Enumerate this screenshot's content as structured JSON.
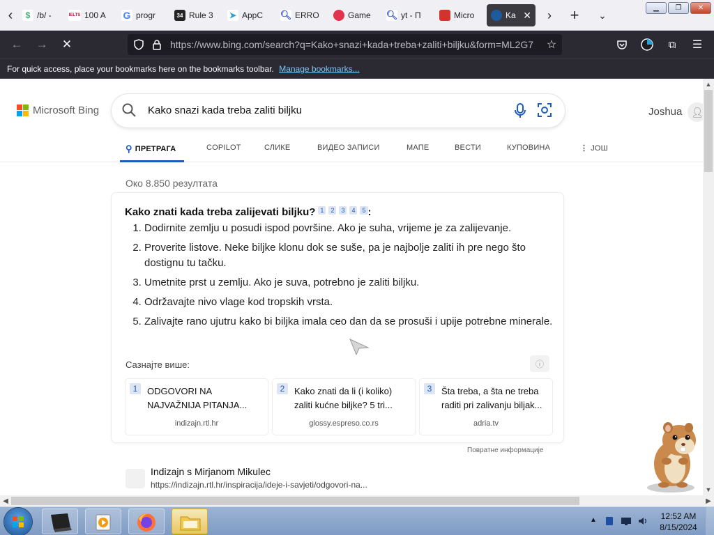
{
  "browser": {
    "tabs": [
      {
        "label": "/b/ - ",
        "icon": "page-icon",
        "color": "#4a7"
      },
      {
        "label": "100 A",
        "icon": "ielts-icon",
        "color": "#c8102e",
        "badge": "IELTS"
      },
      {
        "label": "progr",
        "icon": "google-icon",
        "color": "#4285f4"
      },
      {
        "label": "Rule 3",
        "icon": "rule34-icon",
        "color": "#2b5"
      },
      {
        "label": "AppC",
        "icon": "telegram-icon",
        "color": "#2aa1da"
      },
      {
        "label": "ERRO",
        "icon": "search-icon",
        "color": "#3b5bdb"
      },
      {
        "label": "Game",
        "icon": "game-icon",
        "color": "#e2334c"
      },
      {
        "label": "yt - П",
        "icon": "search-icon",
        "color": "#3b5bdb"
      },
      {
        "label": "Micro",
        "icon": "microsoft-icon",
        "color": "#d0342c"
      },
      {
        "label": "Kak",
        "icon": "bing-icon",
        "color": "#1e5a9e",
        "active": true
      }
    ],
    "url": "https://www.bing.com/search?q=Kako+snazi+kada+treba+zaliti+biljku&form=ML2G7",
    "bookmarks_hint": "For quick access, place your bookmarks here on the bookmarks toolbar.",
    "bookmarks_link": "Manage bookmarks..."
  },
  "bing": {
    "logo_text": "Microsoft Bing",
    "query": "Kako snazi kada treba zaliti biljku",
    "user_name": "Joshua",
    "tabs": [
      "ПРЕТРАГА",
      "COPILOT",
      "СЛИКЕ",
      "ВИДЕО ЗАПИСИ",
      "МАПЕ",
      "ВЕСТИ",
      "КУПОВИНА",
      "ЈОШ"
    ],
    "result_count": "Око 8.850 резултата",
    "answer": {
      "title": "Kako znati kada treba zalijevati biljku?",
      "title_suffix": ":",
      "citations": [
        "1",
        "2",
        "3",
        "4",
        "5"
      ],
      "steps": [
        "Dodirnite zemlju u posudi ispod površine. Ako je suha, vrijeme je za zalijevanje.",
        "Proverite listove. Neke biljke klonu dok se suše, pa je najbolje zaliti ih pre nego što dostignu tu tačku.",
        "Umetnite prst u zemlju. Ako je suva, potrebno je zaliti biljku.",
        "Održavajte nivo vlage kod tropskih vrsta.",
        "Zalivajte rano ujutru kako bi biljka imala ceo dan da se prosuši i upije potrebne minerale."
      ],
      "learn_more": "Сазнајте више:",
      "sources": [
        {
          "num": "1",
          "title": "ODGOVORI NA NAJVAŽNIJA PITANJA...",
          "domain": "indizajn.rtl.hr"
        },
        {
          "num": "2",
          "title": "Kako znati da li (i koliko) zaliti kućne biljke? 5 tri...",
          "domain": "glossy.espreso.co.rs"
        },
        {
          "num": "3",
          "title": "Šta treba, a šta ne treba raditi pri zalivanju biljak...",
          "domain": "adria.tv"
        }
      ],
      "feedback": "Повратне информације"
    },
    "first_result": {
      "site": "Indizajn s Mirjanom Mikulec",
      "url": "https://indizajn.rtl.hr/inspiracija/ideje-i-savjeti/odgovori-na..."
    }
  },
  "taskbar": {
    "time": "12:52 AM",
    "date": "8/15/2024"
  }
}
